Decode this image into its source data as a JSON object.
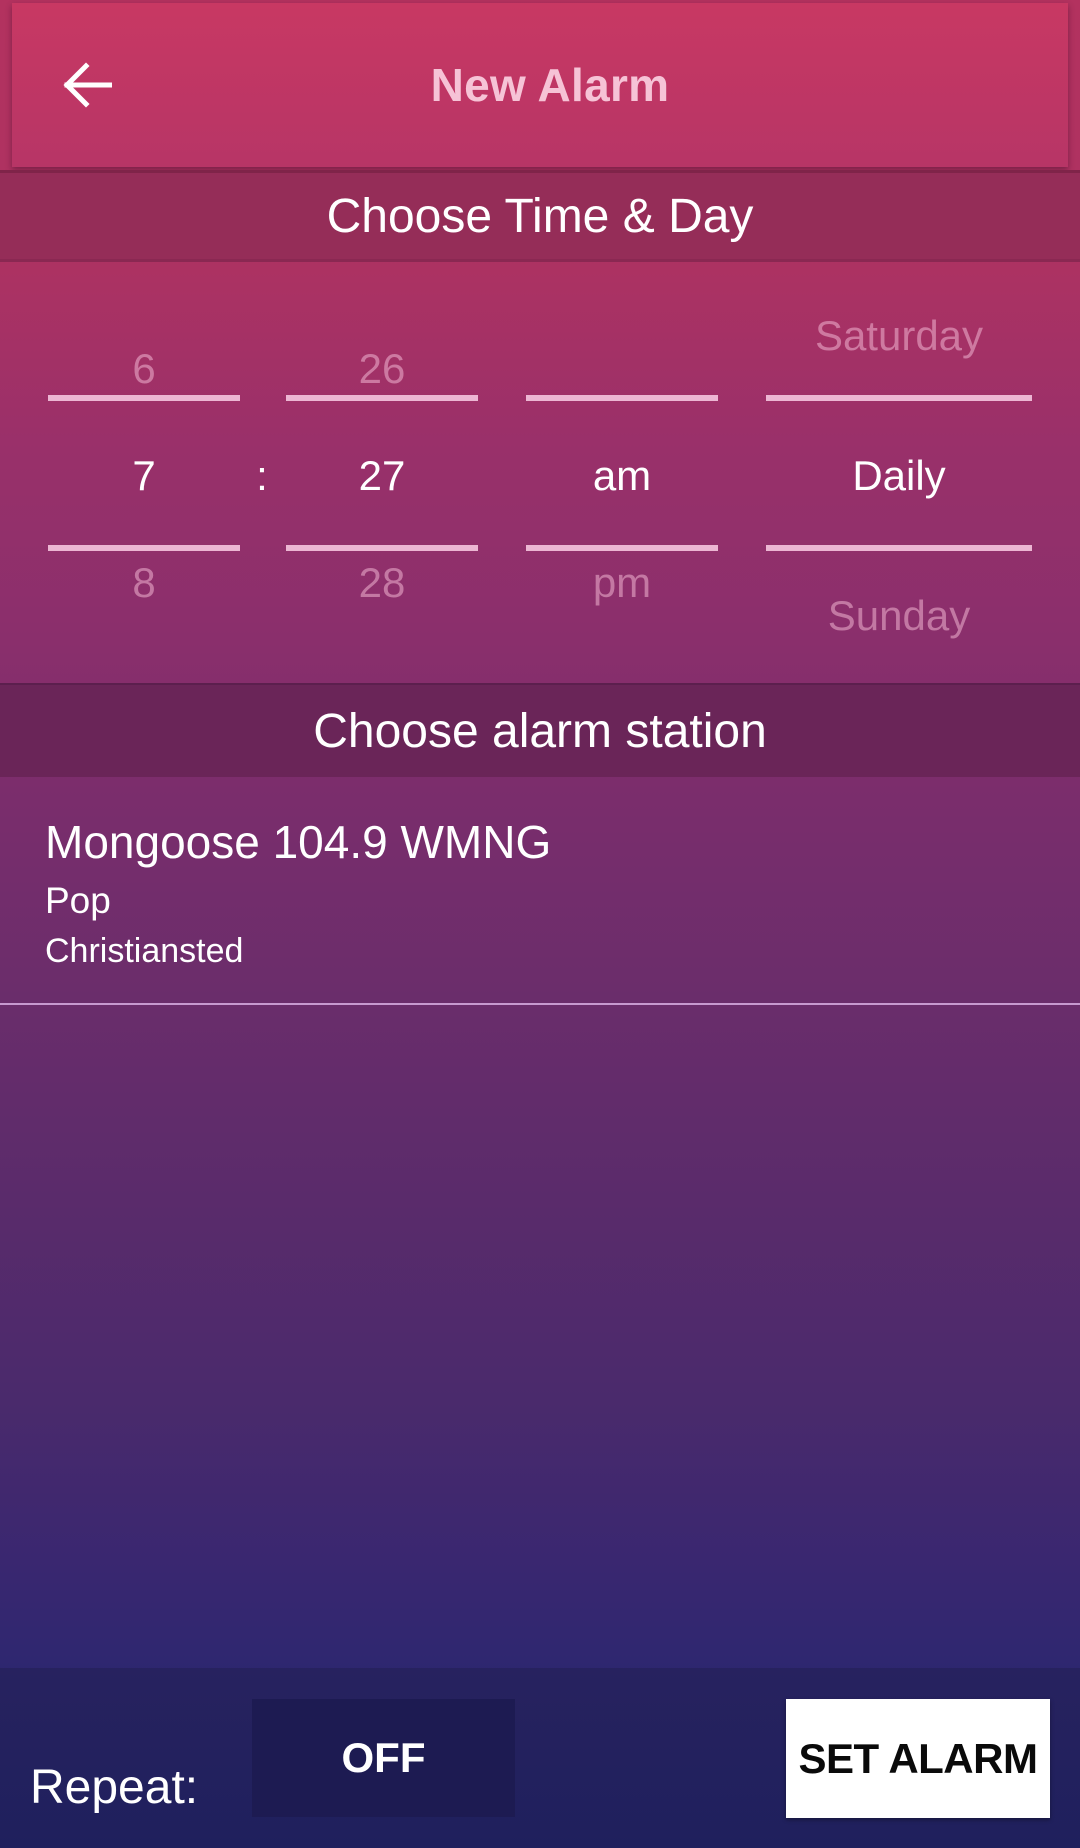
{
  "header": {
    "title": "New Alarm",
    "back_icon": "arrow-left-icon"
  },
  "sections": {
    "time_day": "Choose Time & Day",
    "station": "Choose alarm station"
  },
  "picker": {
    "hour": {
      "prev": "6",
      "selected": "7",
      "next": "8"
    },
    "separator": ":",
    "minute": {
      "prev": "26",
      "selected": "27",
      "next": "28"
    },
    "ampm": {
      "prev": "",
      "selected": "am",
      "next": "pm"
    },
    "day": {
      "prev": "Saturday",
      "selected": "Daily",
      "next": "Sunday"
    }
  },
  "station": {
    "name": "Mongoose 104.9 WMNG",
    "genre": "Pop",
    "city": "Christiansted"
  },
  "footer": {
    "repeat_label": "Repeat:",
    "repeat_value": "OFF",
    "set_alarm_label": "SET ALARM"
  },
  "colors": {
    "header_bg": "#c23766",
    "header_title": "#f6c3d6",
    "divider": "#ecb6d3",
    "set_alarm_bg": "#ffffff",
    "repeat_toggle_bg": "#1d1b52"
  }
}
